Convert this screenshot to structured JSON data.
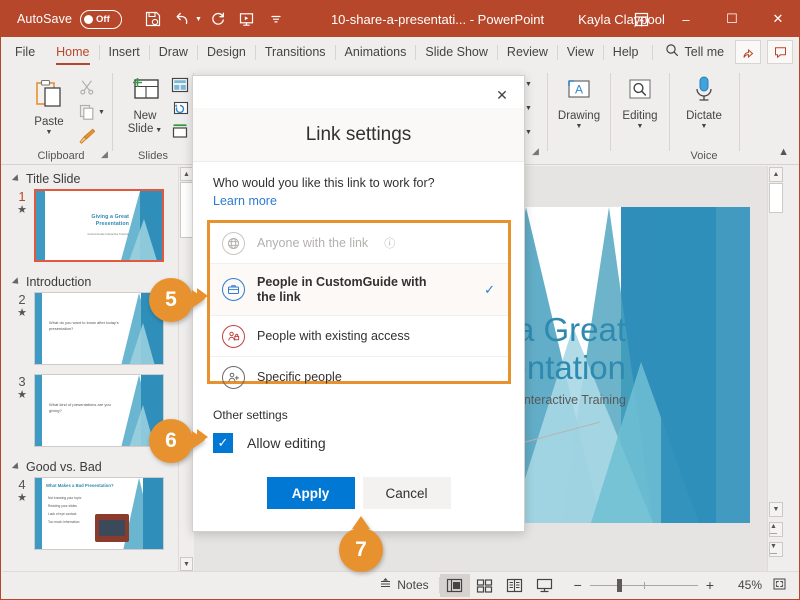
{
  "titlebar": {
    "autosave_label": "AutoSave",
    "autosave_state": "Off",
    "document_title": "10-share-a-presentati...",
    "app_name": "PowerPoint",
    "title_separator": "-",
    "user_name": "Kayla Claypool",
    "minimize": "–",
    "maximize": "☐",
    "close": "✕",
    "qat": [
      "save-icon",
      "undo-icon",
      "redo-icon",
      "start-presentation-icon",
      "customize-qat-icon"
    ]
  },
  "tabs": [
    {
      "label": "File",
      "active": false
    },
    {
      "label": "Home",
      "active": true
    },
    {
      "label": "Insert",
      "active": false
    },
    {
      "label": "Draw",
      "active": false
    },
    {
      "label": "Design",
      "active": false
    },
    {
      "label": "Transitions",
      "active": false
    },
    {
      "label": "Animations",
      "active": false
    },
    {
      "label": "Slide Show",
      "active": false
    },
    {
      "label": "Review",
      "active": false
    },
    {
      "label": "View",
      "active": false
    },
    {
      "label": "Help",
      "active": false
    }
  ],
  "tellme": {
    "label": "Tell me",
    "icon": "search-icon"
  },
  "ribbon": {
    "groups": [
      {
        "name": "Clipboard",
        "label": "Clipboard"
      },
      {
        "name": "Slides",
        "label": "Slides"
      },
      {
        "name": "Voice",
        "label": "Voice"
      }
    ],
    "paste_label": "Paste",
    "new_slide_label": "New\nSlide",
    "new_slide_line1": "New",
    "new_slide_line2": "Slide",
    "drawing_label": "Drawing",
    "editing_label": "Editing",
    "dictate_label": "Dictate",
    "collapse_ribbon": "collapse-ribbon-icon"
  },
  "slide_panel": {
    "sections": [
      {
        "title": "Title Slide",
        "slides": [
          {
            "number": "1",
            "star": "★",
            "selected": true,
            "title_line1": "Giving a Great",
            "title_line2": "Presentation",
            "subtitle": "CustomGuide Interactive Training"
          }
        ]
      },
      {
        "title": "Introduction",
        "slides": [
          {
            "number": "2",
            "star": "★",
            "selected": false,
            "body": "What do you want to know after today's presentation?"
          },
          {
            "number": "3",
            "star": "★",
            "selected": false,
            "body": "What kind of presentations are you giving?"
          }
        ]
      },
      {
        "title": "Good vs. Bad",
        "slides": [
          {
            "number": "4",
            "star": "★",
            "selected": false,
            "body": "What Makes a Bad Presentation?",
            "bullets": [
              "Not knowing your topic",
              "Reading your slides",
              "Lack of eye contact",
              "Too much information"
            ]
          }
        ]
      }
    ]
  },
  "main_slide": {
    "title_line1": "Giving a Great",
    "title_line2": "Presentation",
    "subtitle": "CustomGuide Interactive Training"
  },
  "dialog": {
    "title": "Link settings",
    "close_icon": "close-icon",
    "question": "Who would you like this link to work for?",
    "learn_more": "Learn more",
    "options": [
      {
        "label": "Anyone with the link",
        "icon": "globe-icon",
        "disabled": true,
        "selected": false,
        "info": "ⓘ"
      },
      {
        "label": "People in CustomGuide with the link",
        "icon": "briefcase-icon",
        "disabled": false,
        "selected": true,
        "check": "✓"
      },
      {
        "label": "People with existing access",
        "icon": "people-lock-icon",
        "disabled": false,
        "selected": false
      },
      {
        "label": "Specific people",
        "icon": "people-add-icon",
        "disabled": false,
        "selected": false
      }
    ],
    "other_settings_label": "Other settings",
    "allow_editing_label": "Allow editing",
    "allow_editing_checked": true,
    "apply_label": "Apply",
    "cancel_label": "Cancel"
  },
  "badges": [
    {
      "number": "5",
      "direction": "right"
    },
    {
      "number": "6",
      "direction": "right"
    },
    {
      "number": "7",
      "direction": "up"
    }
  ],
  "statusbar": {
    "notes_label": "Notes",
    "views": [
      "normal-view-icon",
      "slide-sorter-icon",
      "reading-view-icon",
      "slideshow-icon"
    ],
    "zoom_out": "−",
    "zoom_in": "+",
    "zoom_percent": "45%",
    "fit_icon": "fit-slide-icon"
  },
  "colors": {
    "brand": "#b7472a",
    "accent_blue": "#0078d4",
    "badge_orange": "#e8922f",
    "slide_teal": "#2e8ab0"
  }
}
